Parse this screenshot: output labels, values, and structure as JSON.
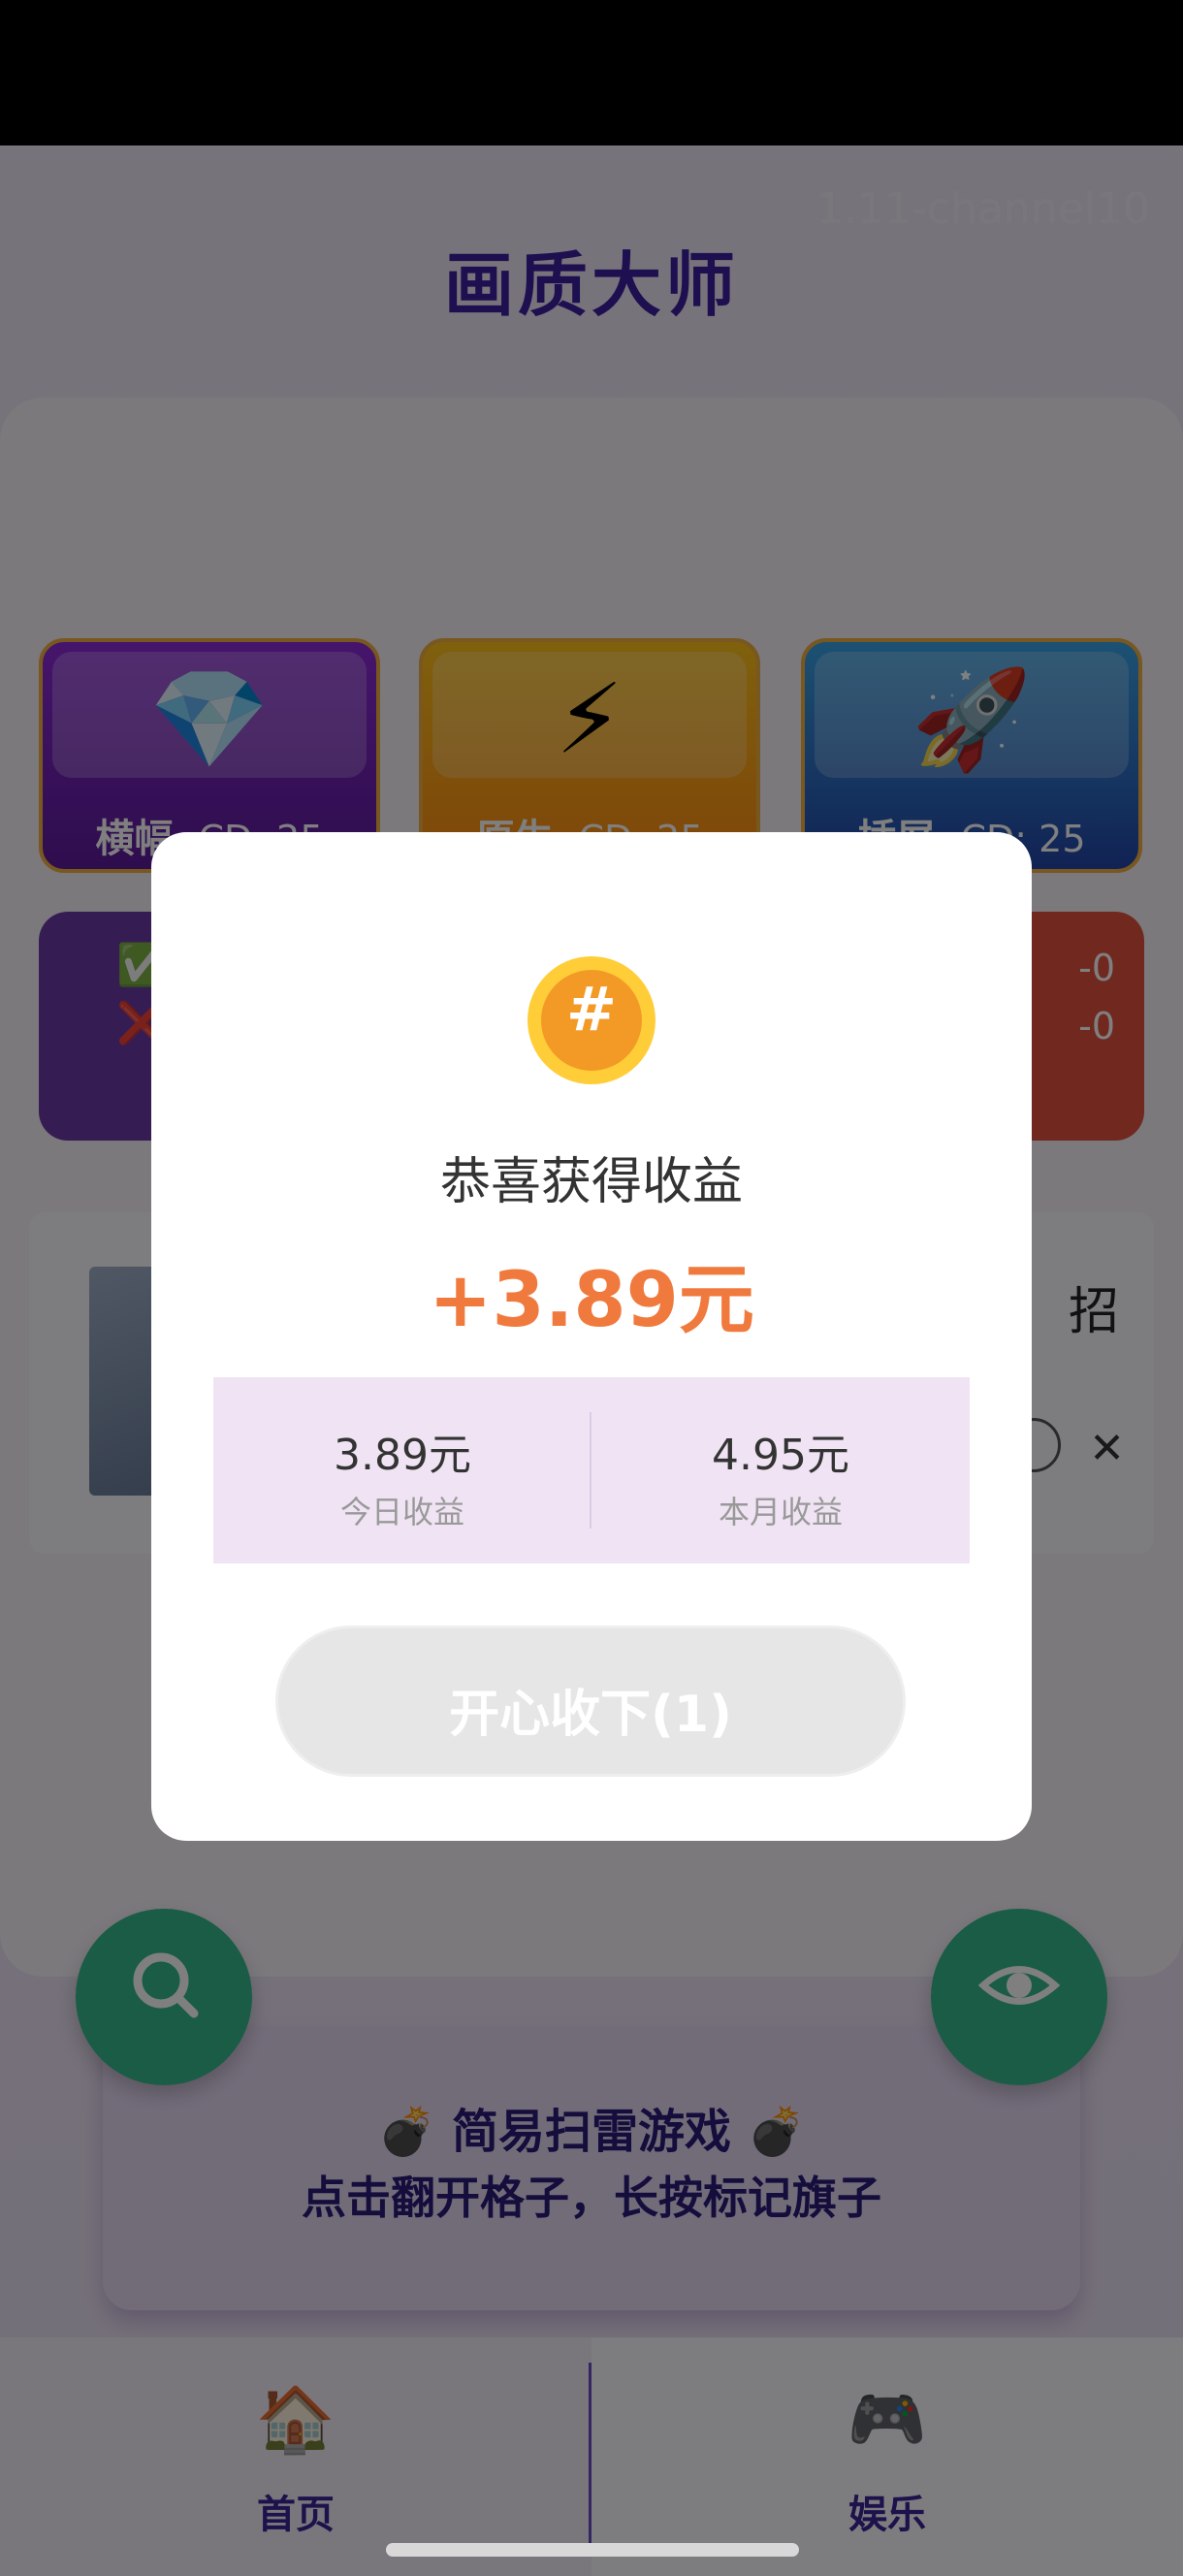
{
  "app": {
    "watermark": "1.11-channel10",
    "title": "画质大师"
  },
  "modes": [
    {
      "label": "横幅",
      "cd": "CD: 25",
      "icon": "💎",
      "icon_name": "diamond-icon"
    },
    {
      "label": "原生",
      "cd": "CD: 25",
      "icon": "⚡",
      "icon_name": "lightning-icon"
    },
    {
      "label": "插屏",
      "cd": "CD: 25",
      "icon": "🚀",
      "icon_name": "rocket-icon"
    }
  ],
  "stats_cards": {
    "left": {
      "line1": "✅",
      "line2": "❌"
    },
    "right": {
      "line1": "-0",
      "line2": "-0"
    }
  },
  "news": {
    "trail_text": "招",
    "close": "✕"
  },
  "fab": {
    "left_icon": "search-icon",
    "right_icon": "eye-icon"
  },
  "game_banner": {
    "line1": "💣 简易扫雷游戏 💣",
    "line2": "点击翻开格子，长按标记旗子"
  },
  "bottom_nav": [
    {
      "label": "首页",
      "icon": "🏠",
      "icon_name": "home-icon"
    },
    {
      "label": "娱乐",
      "icon": "🎮",
      "icon_name": "gamepad-icon"
    }
  ],
  "dialog": {
    "coin_glyph": "#",
    "title": "恭喜获得收益",
    "amount": "+3.89元",
    "today_value": "3.89元",
    "today_label": "今日收益",
    "month_value": "4.95元",
    "month_label": "本月收益",
    "confirm_label": "开心收下(1)"
  },
  "colors": {
    "accent": "#3d1fa0",
    "amount": "#f07a3e",
    "fab": "#34b88c",
    "stats_panel": "#f0e4f4"
  }
}
